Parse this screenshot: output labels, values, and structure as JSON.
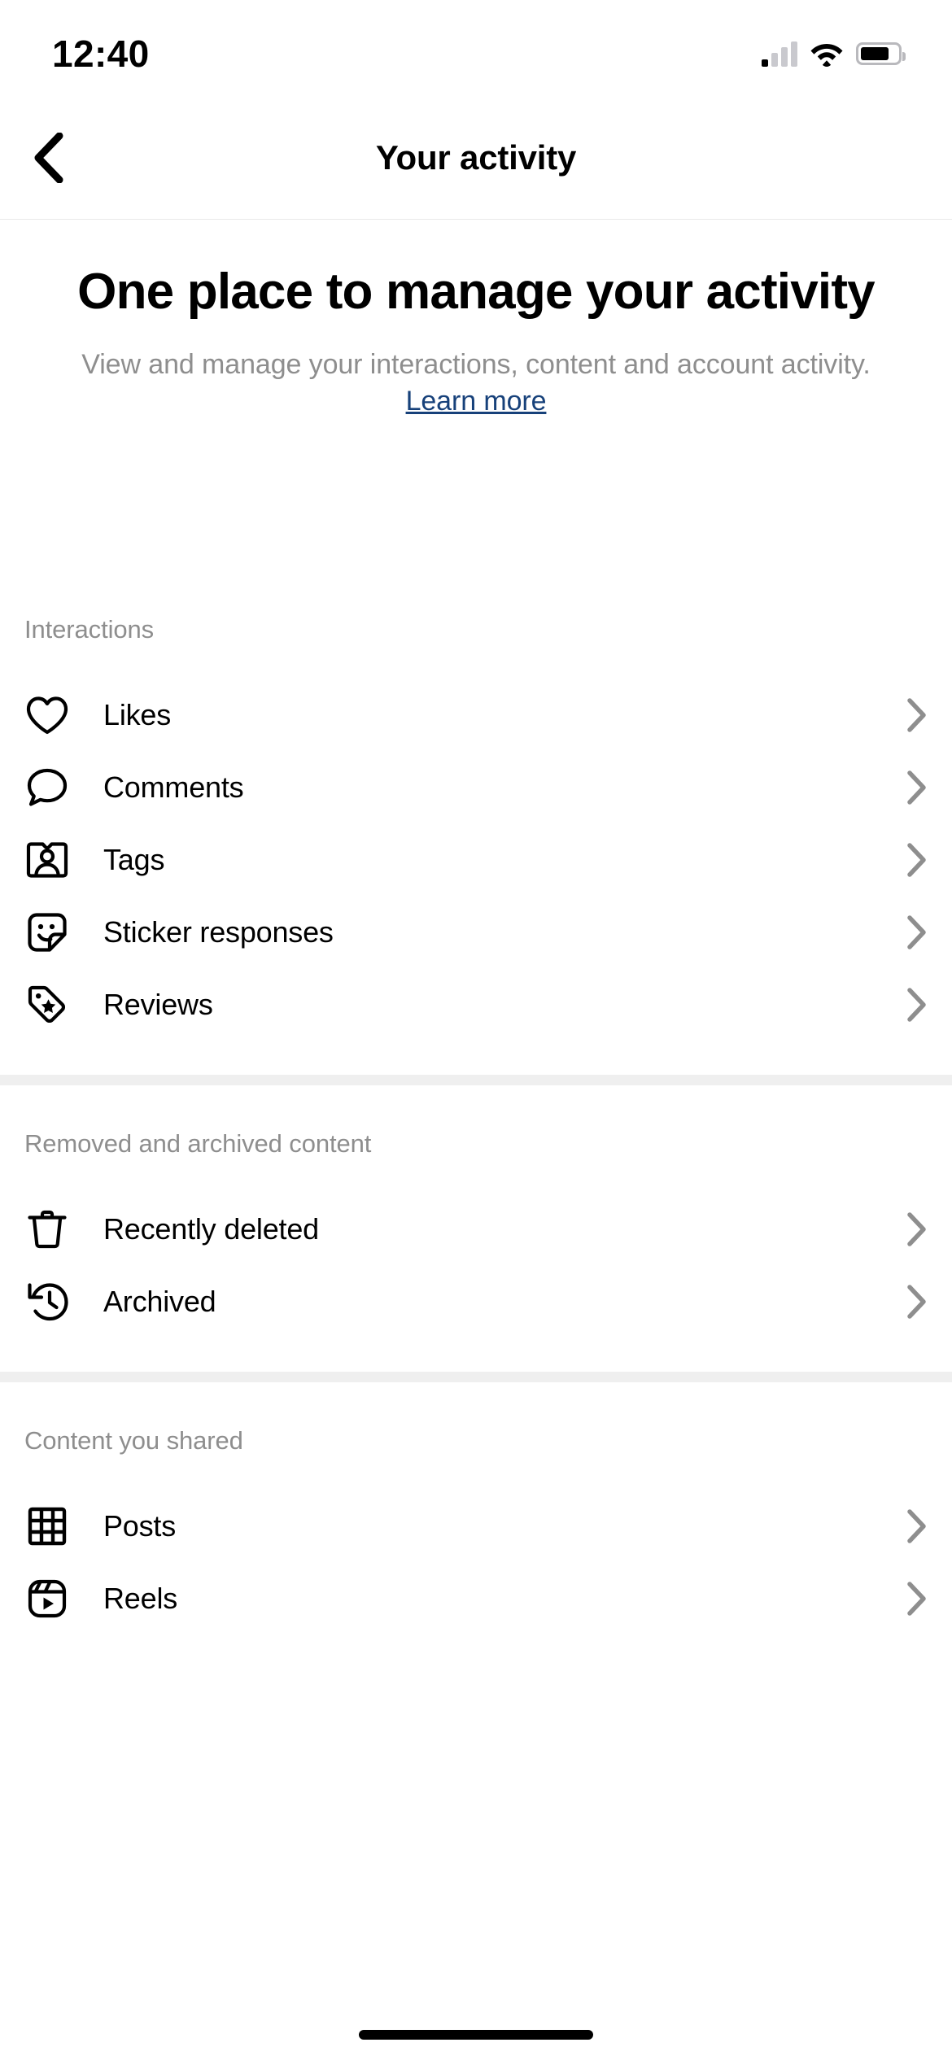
{
  "status_bar": {
    "time": "12:40",
    "signal_icon": "cellular-signal-icon",
    "signal_bars_filled": 1,
    "signal_bars_total": 4,
    "wifi_icon": "wifi-icon",
    "battery_icon": "battery-icon",
    "battery_level_percent": 78
  },
  "navbar": {
    "back_icon": "chevron-left-icon",
    "title": "Your activity"
  },
  "hero": {
    "title": "One place to manage your activity",
    "subtitle": "View and manage your interactions, content and account activity. ",
    "link_label": "Learn more"
  },
  "sections": [
    {
      "title": "Interactions",
      "items": [
        {
          "label": "Likes",
          "icon": "heart-icon",
          "chevron": "chevron-right-icon"
        },
        {
          "label": "Comments",
          "icon": "comment-icon",
          "chevron": "chevron-right-icon"
        },
        {
          "label": "Tags",
          "icon": "tag-person-icon",
          "chevron": "chevron-right-icon"
        },
        {
          "label": "Sticker responses",
          "icon": "sticker-icon",
          "chevron": "chevron-right-icon"
        },
        {
          "label": "Reviews",
          "icon": "price-tag-star-icon",
          "chevron": "chevron-right-icon"
        }
      ]
    },
    {
      "title": "Removed and archived content",
      "items": [
        {
          "label": "Recently deleted",
          "icon": "trash-icon",
          "chevron": "chevron-right-icon"
        },
        {
          "label": "Archived",
          "icon": "history-clock-icon",
          "chevron": "chevron-right-icon"
        }
      ]
    },
    {
      "title": "Content you shared",
      "items": [
        {
          "label": "Posts",
          "icon": "grid-icon",
          "chevron": "chevron-right-icon"
        },
        {
          "label": "Reels",
          "icon": "reels-icon",
          "chevron": "chevron-right-icon"
        }
      ]
    }
  ],
  "colors": {
    "text_primary": "#000000",
    "text_secondary": "#8e8e8e",
    "link": "#17417a",
    "separator": "#efefef",
    "hairline": "#e8e8e8",
    "background": "#ffffff"
  },
  "home_indicator": "home-indicator"
}
